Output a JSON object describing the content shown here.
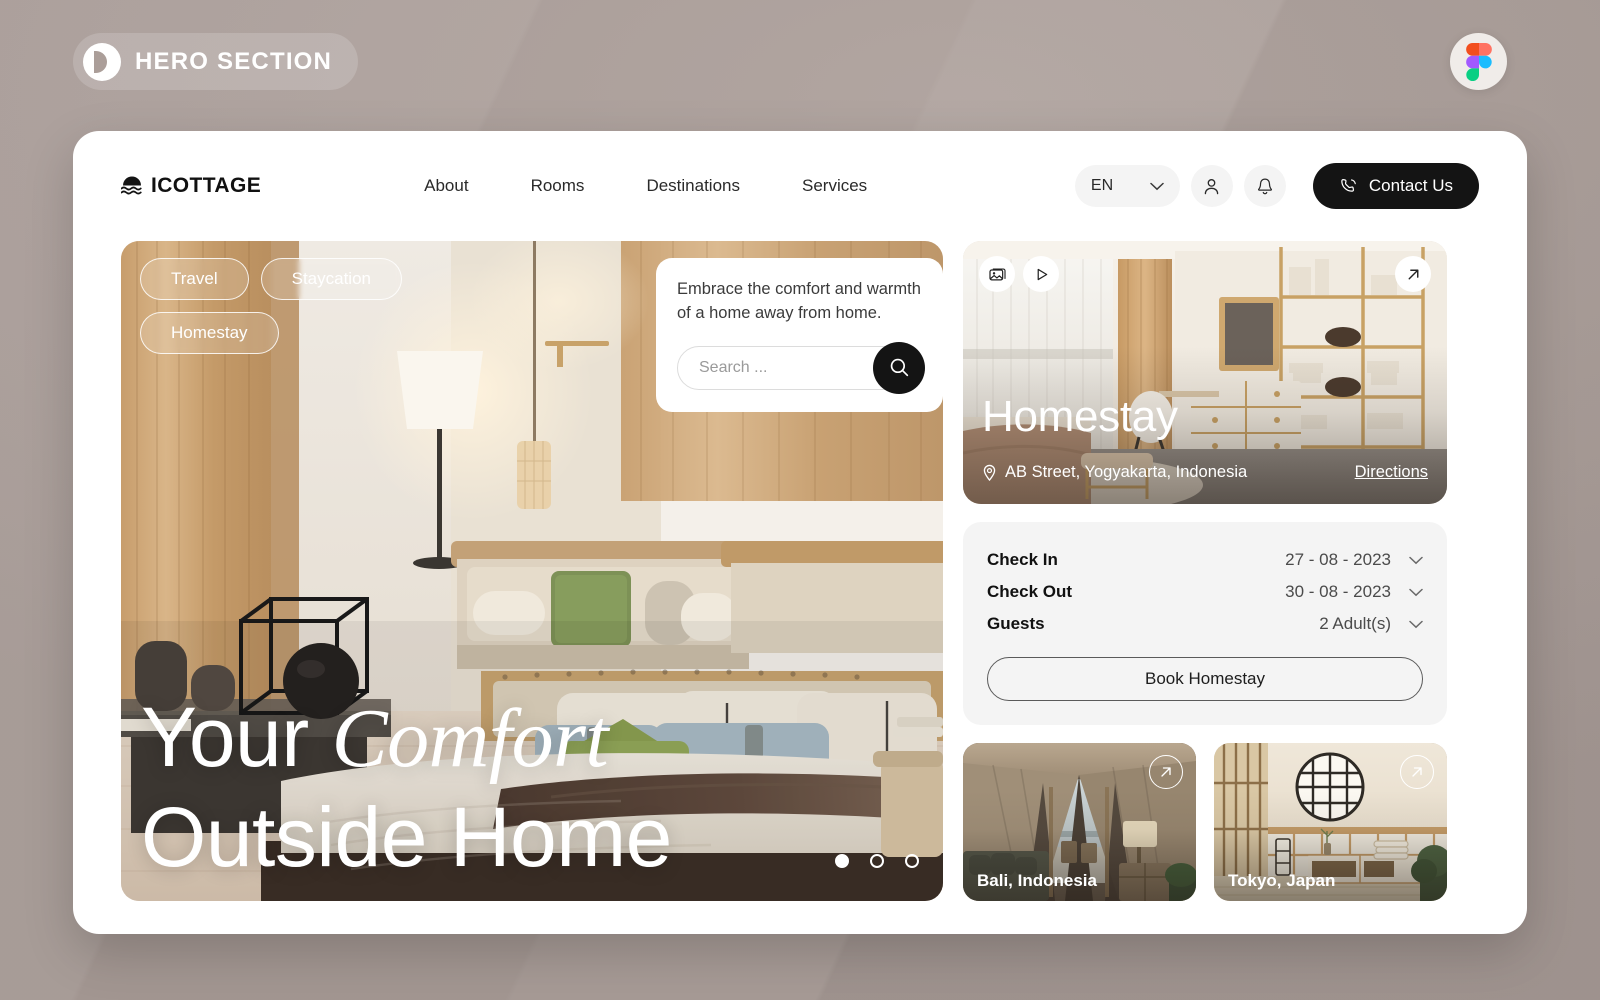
{
  "badge": {
    "text": "HERO SECTION",
    "logo_icon": "pilcrow-circle-icon"
  },
  "figma": {
    "icon": "figma-logo-icon"
  },
  "nav": {
    "brand": "ICOTTAGE",
    "brand_icon": "sunset-waves-icon",
    "links": [
      {
        "label": "About"
      },
      {
        "label": "Rooms"
      },
      {
        "label": "Destinations"
      },
      {
        "label": "Services"
      }
    ],
    "language": "EN",
    "chevron_icon": "chevron-down-icon",
    "user_icon": "user-icon",
    "bell_icon": "bell-icon",
    "contact_label": "Contact Us",
    "contact_icon": "phone-icon"
  },
  "hero": {
    "pills": [
      {
        "label": "Travel"
      },
      {
        "label": "Staycation"
      },
      {
        "label": "Homestay"
      }
    ],
    "search": {
      "tagline": "Embrace the comfort and warmth of a home away from home.",
      "placeholder": "Search ...",
      "value": "",
      "button_icon": "search-icon"
    },
    "title_line1_plain": "Your ",
    "title_line1_italic": "Comfort",
    "title_line2": "Outside Home",
    "carousel": {
      "total": 3,
      "active_index": 0
    }
  },
  "homestay": {
    "title": "Homestay",
    "address": "AB Street, Yogyakarta, Indonesia",
    "address_icon": "map-pin-icon",
    "directions_label": "Directions",
    "gallery_icon": "gallery-icon",
    "play_icon": "play-icon",
    "expand_icon": "arrow-up-right-icon"
  },
  "booking": {
    "rows": [
      {
        "label": "Check In",
        "value": "27 - 08 - 2023"
      },
      {
        "label": "Check Out",
        "value": "30 - 08 - 2023"
      },
      {
        "label": "Guests",
        "value": "2 Adult(s)"
      }
    ],
    "chevron_icon": "chevron-down-icon",
    "book_label": "Book Homestay"
  },
  "destinations": [
    {
      "label": "Bali, Indonesia",
      "arrow_icon": "arrow-up-right-icon"
    },
    {
      "label": "Tokyo, Japan",
      "arrow_icon": "arrow-up-right-icon"
    }
  ],
  "colors": {
    "canvas": "#ab9e99",
    "dark": "#141414",
    "panel": "#f4f4f4"
  }
}
